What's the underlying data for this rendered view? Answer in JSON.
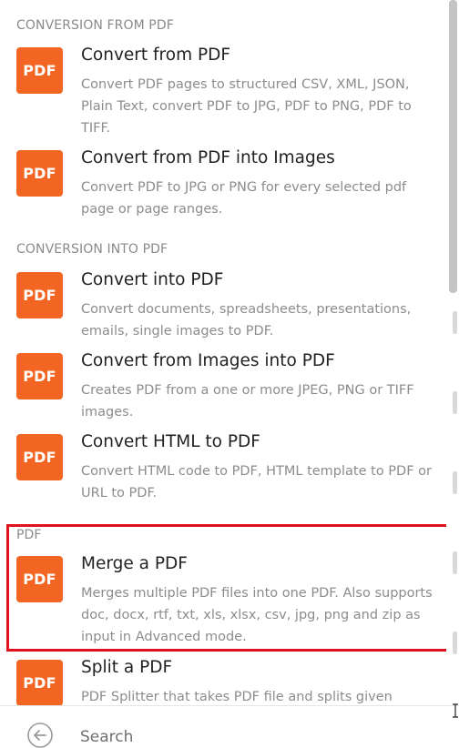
{
  "sections": [
    {
      "header": "CONVERSION FROM PDF"
    },
    {
      "header": "CONVERSION INTO PDF"
    },
    {
      "header": "PDF"
    }
  ],
  "icon_label": "PDF",
  "items": [
    {
      "title": "Convert from PDF",
      "desc": "Convert PDF pages to structured CSV, XML, JSON, Plain Text, convert PDF to JPG, PDF to PNG, PDF to TIFF."
    },
    {
      "title": "Convert from PDF into Images",
      "desc": "Convert PDF to JPG or PNG for every selected pdf page or page ranges."
    },
    {
      "title": "Convert into PDF",
      "desc": "Convert documents, spreadsheets, presentations, emails, single images to PDF."
    },
    {
      "title": "Convert from Images into PDF",
      "desc": "Creates PDF from a one or more JPEG, PNG or TIFF images."
    },
    {
      "title": "Convert HTML to PDF",
      "desc": "Convert HTML code to PDF, HTML template to PDF or URL to PDF."
    },
    {
      "title": "Merge a PDF",
      "desc": "Merges multiple PDF files into one PDF. Also supports doc, docx, rtf, txt, xls, xlsx, csv, jpg, png and zip as input in Advanced mode."
    },
    {
      "title": "Split a PDF",
      "desc": "PDF Splitter that takes PDF file and splits given pages"
    }
  ],
  "search": {
    "placeholder": "Search"
  },
  "colors": {
    "icon_bg": "#f26522",
    "highlight": "#e0101e"
  },
  "icons": {
    "back": "circle-arrow-left-icon"
  }
}
